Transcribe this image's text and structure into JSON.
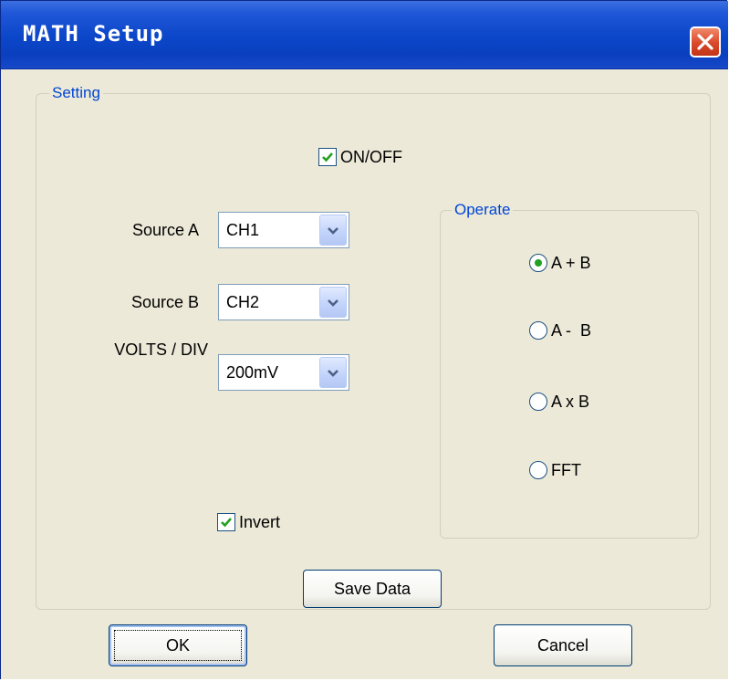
{
  "window": {
    "title": "MATH Setup"
  },
  "setting_group": {
    "legend": "Setting",
    "onoff": {
      "label": "ON/OFF",
      "checked": true
    },
    "source_a": {
      "label": "Source A",
      "value": "CH1"
    },
    "source_b": {
      "label": "Source B",
      "value": "CH2"
    },
    "volts_div": {
      "label": "VOLTS / DIV",
      "value": "200mV"
    },
    "invert": {
      "label": "Invert",
      "checked": true
    },
    "save_data_label": "Save Data"
  },
  "operate_group": {
    "legend": "Operate",
    "options": [
      {
        "label": "A + B",
        "selected": true
      },
      {
        "label": "A -  B",
        "selected": false
      },
      {
        "label": "A x B",
        "selected": false
      },
      {
        "label": "FFT",
        "selected": false
      }
    ]
  },
  "buttons": {
    "ok_label": "OK",
    "cancel_label": "Cancel"
  },
  "colors": {
    "title_bar": "#0b46c8",
    "dialog_bg": "#ece9d8",
    "group_legend": "#0046d5",
    "check": "#21a121",
    "close_button": "#d9482a"
  },
  "icons": {
    "close": "close-x-icon",
    "dropdown": "chevron-down-icon",
    "check": "checkmark-icon"
  }
}
